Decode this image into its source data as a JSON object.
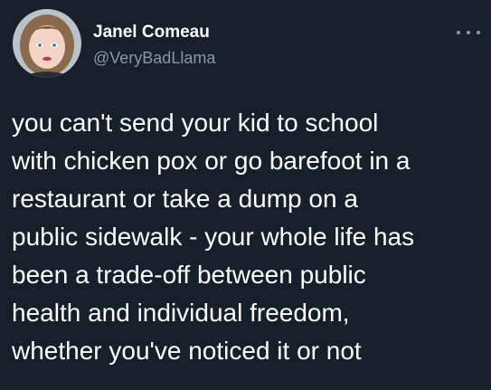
{
  "tweet": {
    "display_name": "Janel Comeau",
    "handle": "@VeryBadLlama",
    "lines": [
      "you can't send your kid to school",
      "with chicken pox or go barefoot in a",
      "restaurant or take a dump on a",
      "public sidewalk - your whole life has",
      "been a trade-off between public",
      "health and individual freedom,",
      "whether you've noticed it or not"
    ],
    "more_icon": "more-horizontal-icon",
    "avatar_icon": "profile-photo"
  },
  "colors": {
    "background": "#15202b",
    "primary_text": "#ffffff",
    "secondary_text": "#8899a6"
  }
}
